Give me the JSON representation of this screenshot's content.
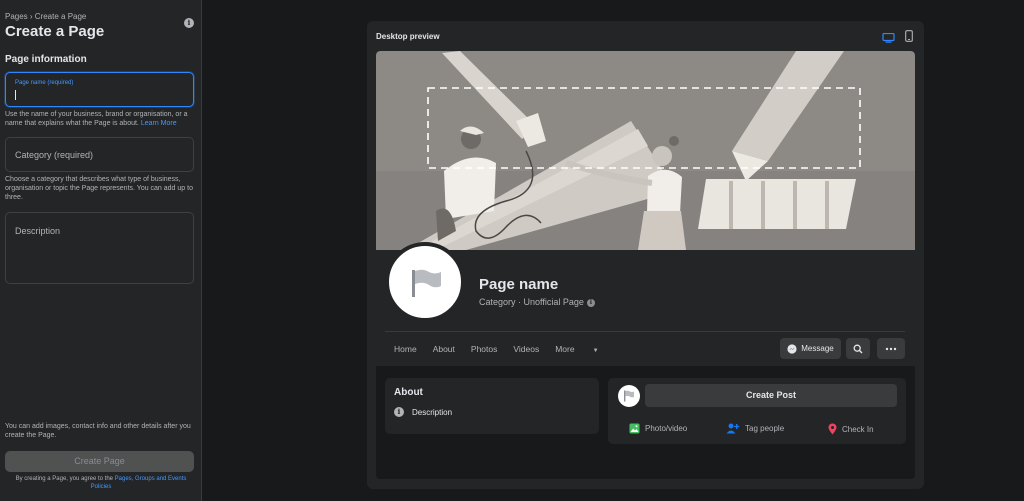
{
  "sidebar": {
    "breadcrumb": "Pages › Create a Page",
    "title": "Create a Page",
    "section_title": "Page information",
    "page_name_label": "Page name (required)",
    "page_name_value": "",
    "page_name_help": "Use the name of your business, brand or organisation, or a name that explains what the Page is about.",
    "learn_more": "Learn More",
    "category_placeholder": "Category (required)",
    "category_help": "Choose a category that describes what type of business, organisation or topic the Page represents. You can add up to three.",
    "description_placeholder": "Description",
    "bottom_note": "You can add images, contact info and other details after you create the Page.",
    "create_button": "Create Page",
    "agree_text": "By creating a Page, you agree to the",
    "policies_link": "Pages, Groups and Events Policies"
  },
  "preview": {
    "title": "Desktop preview",
    "page_name": "Page name",
    "category_line": "Category · Unofficial Page",
    "nav": [
      "Home",
      "About",
      "Photos",
      "Videos",
      "More"
    ],
    "message_button": "Message",
    "about_title": "About",
    "description_label": "Description",
    "create_post": "Create Post",
    "actions": {
      "photo": "Photo/video",
      "tag": "Tag people",
      "checkin": "Check In"
    }
  },
  "colors": {
    "accent": "#2d88ff",
    "photo_green": "#45bd62",
    "tag_blue": "#1877f2",
    "checkin_red": "#f3425f"
  }
}
